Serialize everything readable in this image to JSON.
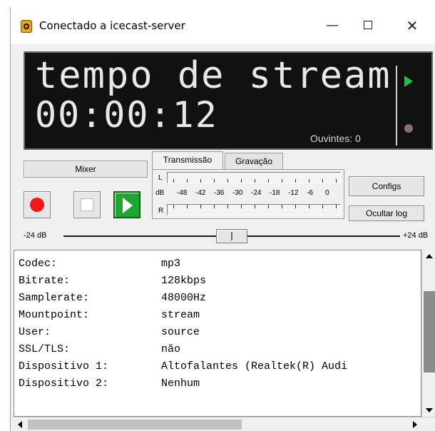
{
  "window": {
    "title": "Conectado a icecast-server",
    "minimize_glyph": "—",
    "close_glyph": "✕"
  },
  "display": {
    "line1": "tempo de stream",
    "line2": "00:00:12",
    "listeners": "Ouvintes: 0"
  },
  "controls": {
    "mixer_label": "Mixer"
  },
  "tabs": [
    {
      "label": "Transmissão",
      "active": true
    },
    {
      "label": "Gravação",
      "active": false
    }
  ],
  "meter": {
    "left_label": "L",
    "right_label": "R",
    "db_label": "dB",
    "scale": [
      "-48",
      "-42",
      "-36",
      "-30",
      "-24",
      "-18",
      "-12",
      "-6",
      "0"
    ]
  },
  "buttons": {
    "configs": "Configs",
    "hide_log": "Ocultar log"
  },
  "slider": {
    "min_label": "-24 dB",
    "max_label": "+24 dB",
    "value_fraction": 0.5
  },
  "log": [
    {
      "key": "Codec:",
      "value": "mp3"
    },
    {
      "key": "Bitrate:",
      "value": "128kbps"
    },
    {
      "key": "Samplerate:",
      "value": "48000Hz"
    },
    {
      "key": "Mountpoint:",
      "value": "stream"
    },
    {
      "key": "User:",
      "value": "source"
    },
    {
      "key": "SSL/TLS:",
      "value": "não"
    },
    {
      "key": "Dispositivo 1:",
      "value": "Altofalantes (Realtek(R) Audi"
    },
    {
      "key": "Dispositivo 2:",
      "value": "Nenhum"
    }
  ],
  "colors": {
    "lcd_background": "#111111",
    "lcd_text": "#e8e8e8",
    "record": "#f01818",
    "play": "#1fa62e"
  },
  "icons": {
    "app": "icecast-speaker-icon",
    "record": "record-icon",
    "stop": "stop-icon",
    "play": "play-icon"
  }
}
